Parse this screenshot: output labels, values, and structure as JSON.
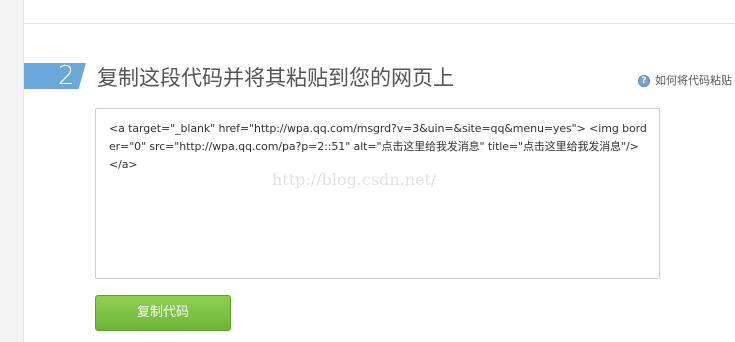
{
  "step": {
    "number": "2",
    "title": "复制这段代码并将其粘贴到您的网页上"
  },
  "help": {
    "icon": "question-circle-icon",
    "label": "如何将代码粘贴"
  },
  "code": {
    "snippet": "<a target=\"_blank\" href=\"http://wpa.qq.com/msgrd?v=3&uin=&site=qq&menu=yes\"> <img border=\"0\" src=\"http://wpa.qq.com/pa?p=2::51\" alt=\"点击这里给我发消息\" title=\"点击这里给我发消息\"/> </a>"
  },
  "watermark": "http://blog.csdn.net/",
  "actions": {
    "copy_label": "复制代码"
  },
  "colors": {
    "badge": "#6aa7db",
    "button": "#7cc242",
    "title_text": "#555555"
  }
}
